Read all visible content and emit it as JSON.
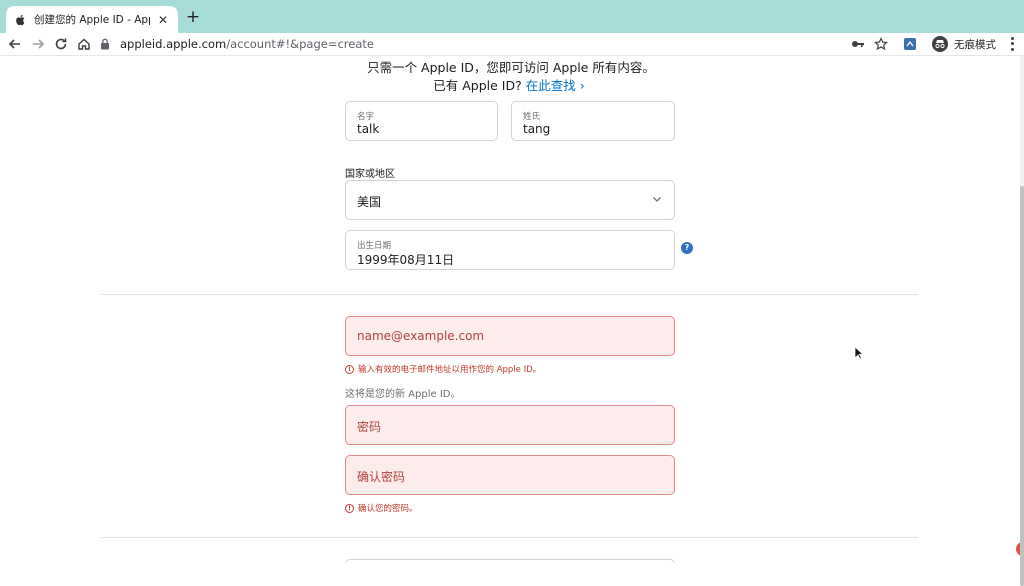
{
  "browser": {
    "tab_title": "创建您的 Apple ID - Apple (中国",
    "url_host": "appleid.apple.com",
    "url_path": "/account#!&page=create",
    "incognito_label": "无痕模式"
  },
  "intro": {
    "line1": "只需一个 Apple ID，您即可访问 Apple 所有内容。",
    "line2_prefix": "已有 Apple ID?",
    "find_link": "在此查找 ›"
  },
  "form": {
    "first_name": {
      "label": "名字",
      "value": "talk"
    },
    "last_name": {
      "label": "姓氏",
      "value": "tang"
    },
    "country": {
      "label": "国家或地区",
      "value": "美国"
    },
    "birthday": {
      "label": "出生日期",
      "value": "1999年08月11日"
    },
    "help_icon": "?",
    "email": {
      "placeholder": "name@example.com",
      "error": "输入有效的电子邮件地址以用作您的 Apple ID。"
    },
    "email_hint": "这将是您的新 Apple ID。",
    "password": {
      "placeholder": "密码"
    },
    "confirm_password": {
      "placeholder": "确认密码",
      "error": "确认您的密码。"
    }
  },
  "colors": {
    "tab_strip": "#a8dcd9",
    "link": "#0070c9",
    "error_text": "#c0392b",
    "error_bg": "#fdecec",
    "error_border": "#e08a8a"
  }
}
